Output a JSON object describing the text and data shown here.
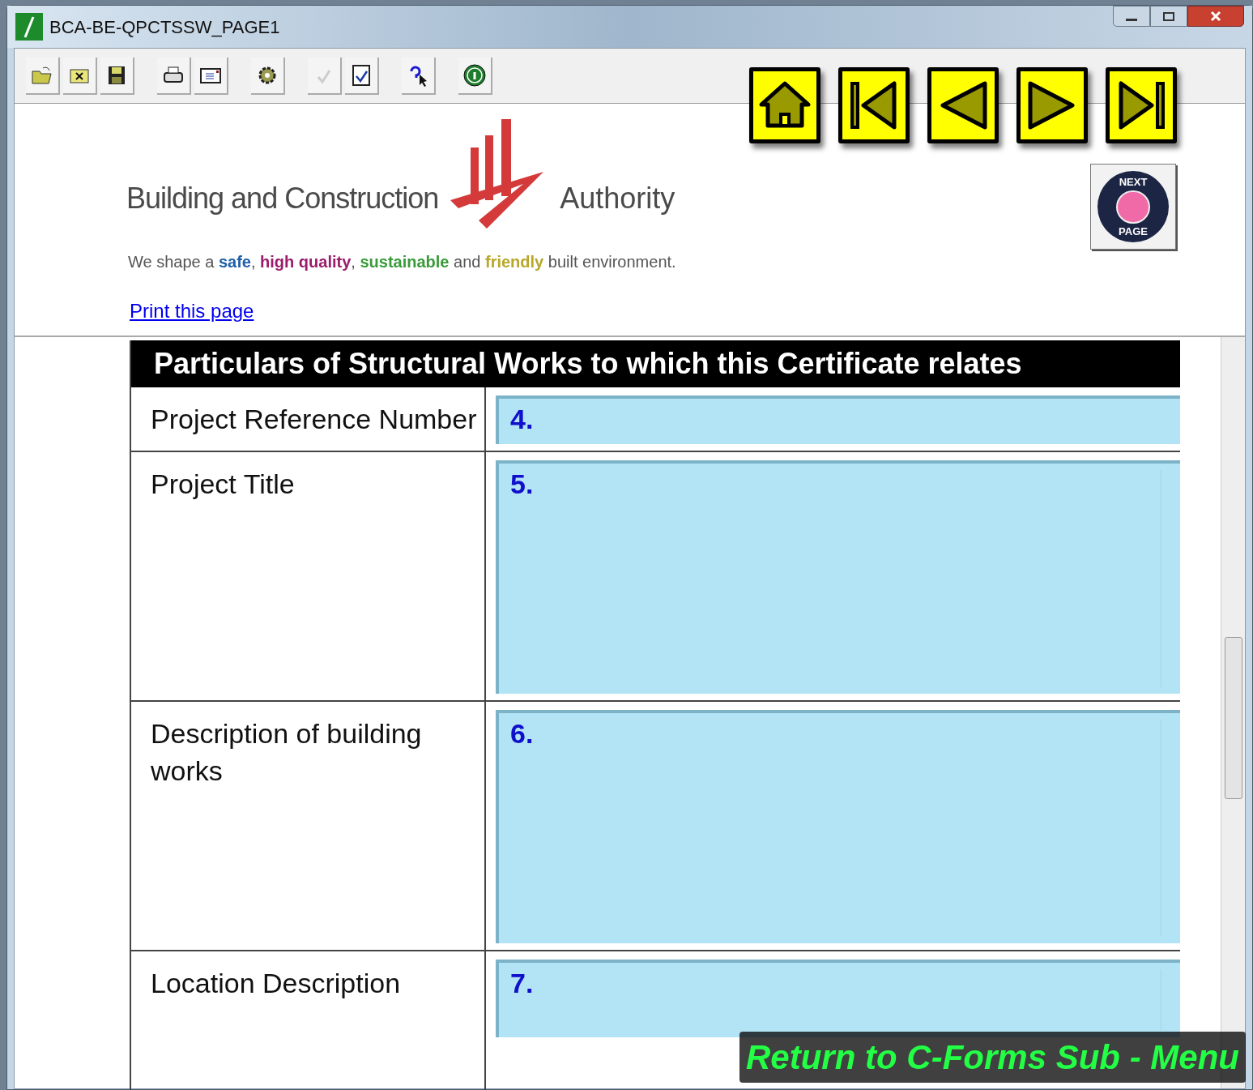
{
  "window": {
    "title": "BCA-BE-QPCTSSW_PAGE1"
  },
  "toolbar": {
    "groups": [
      [
        {
          "kind": "open"
        },
        {
          "kind": "close"
        },
        {
          "kind": "save"
        }
      ],
      [
        {
          "kind": "print"
        },
        {
          "kind": "mail"
        }
      ],
      [
        {
          "kind": "settings"
        }
      ],
      [
        {
          "kind": "spellcheck-disabled"
        },
        {
          "kind": "spellcheck"
        }
      ],
      [
        {
          "kind": "help-pointer"
        }
      ],
      [
        {
          "kind": "info"
        }
      ]
    ]
  },
  "nav_buttons": [
    {
      "kind": "home"
    },
    {
      "kind": "first"
    },
    {
      "kind": "prev"
    },
    {
      "kind": "next"
    },
    {
      "kind": "last"
    }
  ],
  "header": {
    "logo_left": "Building and Construction",
    "logo_right": "Authority",
    "tagline": [
      {
        "text": "We shape a "
      },
      {
        "text": "safe",
        "color": "#1f5fa8"
      },
      {
        "text": ", "
      },
      {
        "text": "high quality",
        "color": "#9c1c6b"
      },
      {
        "text": ", "
      },
      {
        "text": "sustainable",
        "color": "#3a9a3a"
      },
      {
        "text": " and "
      },
      {
        "text": "friendly",
        "color": "#b9a72a"
      },
      {
        "text": " built environment."
      }
    ],
    "print_link": "Print this page",
    "next_page": {
      "top": "NEXT",
      "bottom": "PAGE"
    }
  },
  "form": {
    "heading": "Particulars of Structural Works to which this Certificate relates",
    "rows": [
      {
        "label": "Project Reference Number",
        "number": "4.",
        "kind": "line"
      },
      {
        "label": "Project Title",
        "number": "5.",
        "kind": "area"
      },
      {
        "label": "Description of building works",
        "number": "6.",
        "kind": "area"
      },
      {
        "label": "Location Description",
        "number": "7.",
        "kind": "area"
      }
    ]
  },
  "return_link": "Return to C-Forms Sub - Menu"
}
